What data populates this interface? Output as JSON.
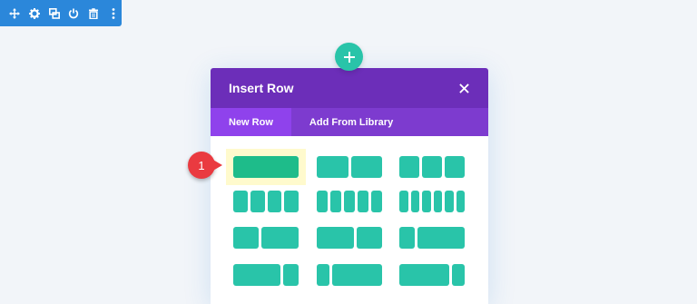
{
  "toolbar": {
    "buttons": [
      {
        "name": "move-icon"
      },
      {
        "name": "gear-icon"
      },
      {
        "name": "duplicate-icon"
      },
      {
        "name": "power-icon"
      },
      {
        "name": "trash-icon"
      },
      {
        "name": "more-icon"
      }
    ],
    "color": "#2b87da"
  },
  "insert_button": {
    "icon": "plus-icon",
    "color": "#29c4a9"
  },
  "modal": {
    "title": "Insert Row",
    "header_color": "#6c2eb9",
    "tabs": [
      {
        "label": "New Row",
        "active": true
      },
      {
        "label": "Add From Library",
        "active": false
      }
    ]
  },
  "layouts": [
    {
      "columns": [
        1
      ]
    },
    {
      "columns": [
        1,
        1
      ]
    },
    {
      "columns": [
        1,
        1,
        1
      ]
    },
    {
      "columns": [
        1,
        1,
        1,
        1
      ]
    },
    {
      "columns": [
        1,
        1,
        1,
        1,
        1
      ]
    },
    {
      "columns": [
        1,
        1,
        1,
        1,
        1,
        1
      ]
    },
    {
      "columns": [
        2,
        3
      ]
    },
    {
      "columns": [
        3,
        2
      ]
    },
    {
      "columns": [
        1,
        3
      ]
    },
    {
      "columns": [
        3,
        1
      ]
    },
    {
      "columns": [
        1,
        4
      ]
    },
    {
      "columns": [
        4,
        1
      ]
    }
  ],
  "annotation": {
    "step": "1"
  },
  "accent_color": "#29c4a9"
}
